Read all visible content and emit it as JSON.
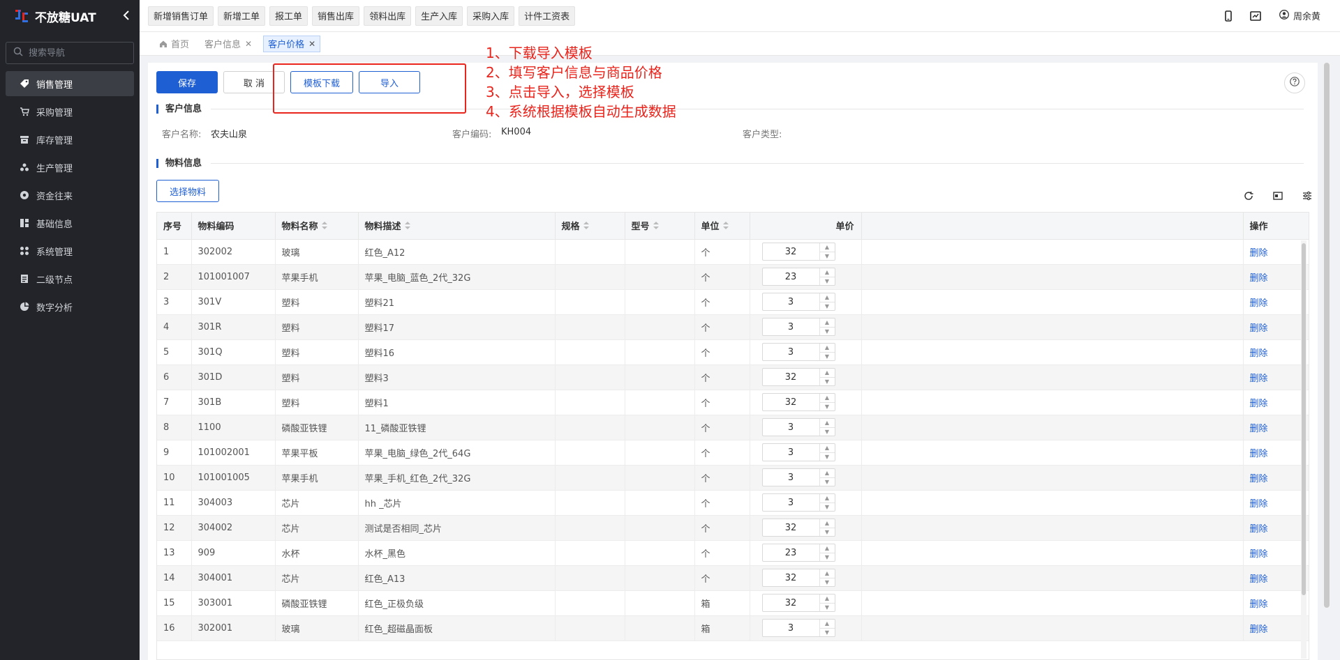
{
  "app": {
    "title": "不放糖UAT",
    "collapse_icon": "chevron-left-icon"
  },
  "sidebar": {
    "search_placeholder": "搜索导航",
    "items": [
      {
        "label": "销售管理",
        "icon": "tag-icon",
        "active": true
      },
      {
        "label": "采购管理",
        "icon": "cart-icon",
        "active": false
      },
      {
        "label": "库存管理",
        "icon": "inventory-icon",
        "active": false
      },
      {
        "label": "生产管理",
        "icon": "production-icon",
        "active": false
      },
      {
        "label": "资金往来",
        "icon": "money-icon",
        "active": false
      },
      {
        "label": "基础信息",
        "icon": "basic-info-icon",
        "active": false
      },
      {
        "label": "系统管理",
        "icon": "system-icon",
        "active": false
      },
      {
        "label": "二级节点",
        "icon": "node-icon",
        "active": false
      },
      {
        "label": "数字分析",
        "icon": "pie-chart-icon",
        "active": false
      }
    ]
  },
  "topbar": {
    "quick_buttons": [
      "新增销售订单",
      "新增工单",
      "报工单",
      "销售出库",
      "领料出库",
      "生产入库",
      "采购入库",
      "计件工资表"
    ],
    "username": "周余黄"
  },
  "tabs": [
    {
      "label": "首页",
      "icon": "home-icon",
      "closable": false,
      "active": false
    },
    {
      "label": "客户信息",
      "closable": true,
      "active": false
    },
    {
      "label": "客户价格",
      "closable": true,
      "active": true
    }
  ],
  "actions": {
    "save": "保存",
    "cancel": "取 消",
    "template_download": "模板下载",
    "import": "导入"
  },
  "customer_section": {
    "title": "客户信息",
    "name_label": "客户名称:",
    "name_value": "农夫山泉",
    "code_label": "客户编码:",
    "code_value": "KH004",
    "type_label": "客户类型:",
    "type_value": ""
  },
  "material_section": {
    "title": "物料信息",
    "select_button": "选择物料"
  },
  "table": {
    "headers": [
      "序号",
      "物料编码",
      "物料名称",
      "物料描述",
      "规格",
      "型号",
      "单位",
      "单价",
      "操作"
    ],
    "delete_label": "删除",
    "rows": [
      {
        "no": "1",
        "code": "302002",
        "name": "玻璃",
        "desc": "红色_A12",
        "spec": "",
        "model": "",
        "unit": "个",
        "price": "32"
      },
      {
        "no": "2",
        "code": "101001007",
        "name": "苹果手机",
        "desc": "苹果_电脑_蓝色_2代_32G",
        "spec": "",
        "model": "",
        "unit": "个",
        "price": "23"
      },
      {
        "no": "3",
        "code": "301V",
        "name": "塑料",
        "desc": "塑料21",
        "spec": "",
        "model": "",
        "unit": "个",
        "price": "3"
      },
      {
        "no": "4",
        "code": "301R",
        "name": "塑料",
        "desc": "塑料17",
        "spec": "",
        "model": "",
        "unit": "个",
        "price": "3"
      },
      {
        "no": "5",
        "code": "301Q",
        "name": "塑料",
        "desc": "塑料16",
        "spec": "",
        "model": "",
        "unit": "个",
        "price": "3"
      },
      {
        "no": "6",
        "code": "301D",
        "name": "塑料",
        "desc": "塑料3",
        "spec": "",
        "model": "",
        "unit": "个",
        "price": "32"
      },
      {
        "no": "7",
        "code": "301B",
        "name": "塑料",
        "desc": "塑料1",
        "spec": "",
        "model": "",
        "unit": "个",
        "price": "32"
      },
      {
        "no": "8",
        "code": "1100",
        "name": "磷酸亚铁锂",
        "desc": "11_磷酸亚铁锂",
        "spec": "",
        "model": "",
        "unit": "个",
        "price": "3"
      },
      {
        "no": "9",
        "code": "101002001",
        "name": "苹果平板",
        "desc": "苹果_电脑_绿色_2代_64G",
        "spec": "",
        "model": "",
        "unit": "个",
        "price": "3"
      },
      {
        "no": "10",
        "code": "101001005",
        "name": "苹果手机",
        "desc": "苹果_手机_红色_2代_32G",
        "spec": "",
        "model": "",
        "unit": "个",
        "price": "3"
      },
      {
        "no": "11",
        "code": "304003",
        "name": "芯片",
        "desc": "hh _芯片",
        "spec": "",
        "model": "",
        "unit": "个",
        "price": "3"
      },
      {
        "no": "12",
        "code": "304002",
        "name": "芯片",
        "desc": "测试是否相同_芯片",
        "spec": "",
        "model": "",
        "unit": "个",
        "price": "32"
      },
      {
        "no": "13",
        "code": "909",
        "name": "水杯",
        "desc": "水杯_黑色",
        "spec": "",
        "model": "",
        "unit": "个",
        "price": "23"
      },
      {
        "no": "14",
        "code": "304001",
        "name": "芯片",
        "desc": "红色_A13",
        "spec": "",
        "model": "",
        "unit": "个",
        "price": "32"
      },
      {
        "no": "15",
        "code": "303001",
        "name": "磷酸亚铁锂",
        "desc": "红色_正极负级",
        "spec": "",
        "model": "",
        "unit": "箱",
        "price": "32"
      },
      {
        "no": "16",
        "code": "302001",
        "name": "玻璃",
        "desc": "红色_超磁晶面板",
        "spec": "",
        "model": "",
        "unit": "箱",
        "price": "3"
      }
    ]
  },
  "annotation": {
    "color": "#e8241c",
    "lines": [
      "1、下载导入模板",
      "2、填写客户信息与商品价格",
      "3、点击导入，选择模板",
      "4、系统根据模板自动生成数据"
    ]
  }
}
